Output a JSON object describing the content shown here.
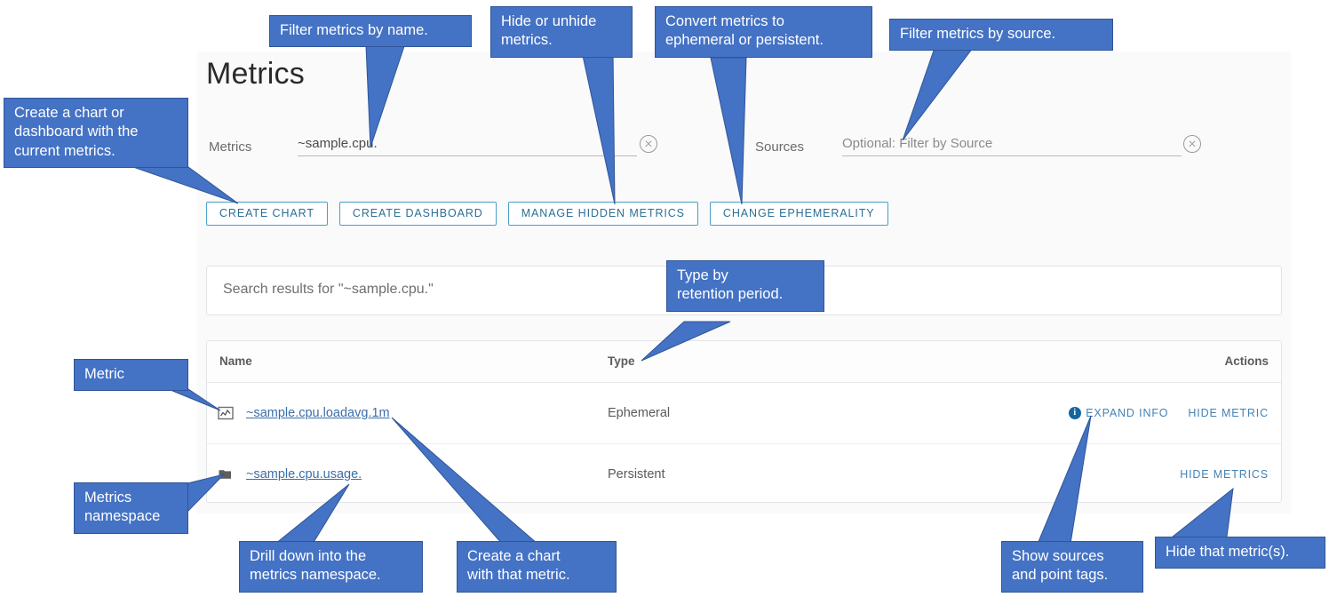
{
  "page": {
    "title": "Metrics"
  },
  "filters": {
    "metrics_label": "Metrics",
    "metrics_value": "~sample.cpu.",
    "metrics_clear_icon": "clear-circle-icon",
    "sources_label": "Sources",
    "sources_value": "",
    "sources_placeholder": "Optional: Filter by Source",
    "sources_clear_icon": "clear-circle-icon"
  },
  "buttons": [
    {
      "id": "create-chart",
      "label": "CREATE CHART"
    },
    {
      "id": "create-dashboard",
      "label": "CREATE DASHBOARD"
    },
    {
      "id": "manage-hidden-metrics",
      "label": "MANAGE HIDDEN METRICS"
    },
    {
      "id": "change-ephemerality",
      "label": "CHANGE EPHEMERALITY"
    }
  ],
  "search": {
    "results_text": "Search results for \"~sample.cpu.\""
  },
  "table": {
    "headers": {
      "name": "Name",
      "type": "Type",
      "actions": "Actions"
    },
    "rows": [
      {
        "icon": "line-chart-icon",
        "name": "~sample.cpu.loadavg.1m",
        "type": "Ephemeral",
        "actions": [
          {
            "id": "expand-info",
            "label": "EXPAND INFO",
            "icon": "info-icon"
          },
          {
            "id": "hide-metric",
            "label": "HIDE METRIC",
            "icon": ""
          }
        ]
      },
      {
        "icon": "folder-icon",
        "name": "~sample.cpu.usage.",
        "type": "Persistent",
        "actions": [
          {
            "id": "hide-metrics",
            "label": "HIDE METRICS",
            "icon": ""
          }
        ]
      }
    ]
  },
  "callouts": {
    "create_chart_dashboard": "Create a  chart or\ndashboard with the\ncurrent metrics.",
    "filter_by_name": "Filter metrics by name.",
    "hide_unhide": "Hide or unhide\nmetrics.",
    "convert_ephemeral": "Convert metrics to\nephemeral or persistent.",
    "filter_by_source": "Filter metrics by source.",
    "type_retention": "Type by\nretention period.",
    "metric": "Metric",
    "metrics_namespace": "Metrics\nnamespace",
    "drill_down": "Drill down into the\nmetrics namespace.",
    "create_chart_metric": "Create a chart\nwith that metric.",
    "show_sources": "Show sources\nand point tags.",
    "hide_that_metric": "Hide that metric(s)."
  },
  "colors": {
    "callout_fill": "#4472c4",
    "callout_border": "#2f5597",
    "link": "#3b6ea8",
    "action_link": "#4383b5",
    "button_border": "#4b9fc4",
    "panel_bg": "#fafafa"
  }
}
